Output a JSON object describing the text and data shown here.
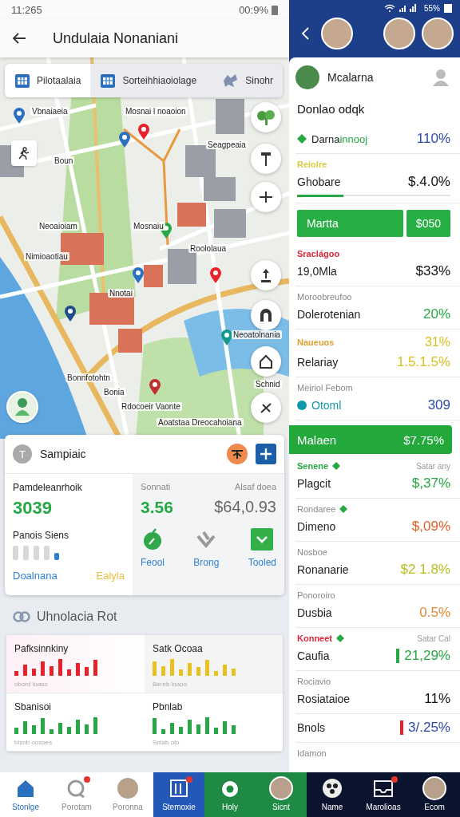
{
  "left_status": {
    "time": "11:265",
    "battery": "00:9%"
  },
  "right_status": {
    "battery": "55%"
  },
  "app_bar": {
    "title": "Undulaia Nonaniani"
  },
  "map_tabs": [
    {
      "label": "Pilotaalaia",
      "selected": true
    },
    {
      "label": "Sorteihhiaoiolage",
      "selected": false
    },
    {
      "label": "Sinohr",
      "selected": false
    }
  ],
  "map_labels": [
    {
      "text": "Vbnaiaeia"
    },
    {
      "text": "Mosnai l noaoion"
    },
    {
      "text": "Boun"
    },
    {
      "text": "Seagpeaia"
    },
    {
      "text": "Neoaioiam"
    },
    {
      "text": "Mosnaiu"
    },
    {
      "text": "Nimioaotiau"
    },
    {
      "text": "Roololaua"
    },
    {
      "text": "Nnotai"
    },
    {
      "text": "Neoatolnania"
    },
    {
      "text": "Bonnfotohtn"
    },
    {
      "text": "Bonia"
    },
    {
      "text": "Rdocoeir Vaonte"
    },
    {
      "text": "Aoatstaa Dreocahoiana"
    },
    {
      "text": "Schnid"
    }
  ],
  "summary_card": {
    "avatar_letter": "T",
    "title": "Sampiaic",
    "left": {
      "label": "Pamdeleanrhoik",
      "value": "3039",
      "sublabel": "Panois Siens",
      "links": [
        {
          "text": "Doalnana",
          "color": "#2f7fd0"
        },
        {
          "text": "Ealyla",
          "color": "#e8c040"
        }
      ]
    },
    "stats": [
      {
        "label": "Sonnati",
        "value": "3.56",
        "color": "#27a844"
      },
      {
        "label": "Alsaf doea",
        "value": "$64,0.93",
        "color": "#666666"
      }
    ],
    "actions": [
      {
        "kind": "apple",
        "label": "Feool"
      },
      {
        "kind": "chevron",
        "label": "Brong"
      },
      {
        "kind": "check",
        "label": "Tooled"
      }
    ]
  },
  "section": {
    "title": "Uhnolacia Rot"
  },
  "tiles": [
    {
      "title": "Pafksinnkiny",
      "caption": "obord loaso",
      "color": "#e8212a"
    },
    {
      "title": "Satk Ocoaa",
      "caption": "Bereb loaoo",
      "color": "#e8c020"
    },
    {
      "title": "Sbanisoi",
      "caption": "bisnb oosoes",
      "color": "#27a844"
    },
    {
      "title": "Pbnlab",
      "caption": "Snlab olo",
      "color": "#27a844"
    }
  ],
  "profile": {
    "name": "Mcalarna",
    "heading": "Donlao odqk"
  },
  "rows": [
    {
      "kind": "tagged",
      "label": "Darna",
      "accent": "innooj",
      "value": "110%",
      "color": "#2a4aa8"
    },
    {
      "kind": "plain",
      "caption": {
        "text": "Reiolre",
        "color": "#d8cc40"
      },
      "label": "Ghobare",
      "value": "$.4.0%",
      "color": "#111111",
      "level": 0.3
    },
    {
      "kind": "button",
      "label": "Martta",
      "value": "$050"
    },
    {
      "kind": "plain",
      "caption": {
        "text": "Sraclágoo",
        "color": "#d8283c"
      },
      "label": "19,0Mla",
      "value": "$33%",
      "color": "#111111"
    },
    {
      "kind": "plain",
      "caption": {
        "text": "Moroobreufoo"
      },
      "label": "Dolerotenian",
      "value": "20%",
      "color": "#27a844"
    },
    {
      "kind": "plain",
      "caption": {
        "text": "Naueuos",
        "color": "#e0a030"
      },
      "caption_value": "31%",
      "label": "Relariay",
      "value": "1.5.1.5%",
      "color": "#d8c020"
    },
    {
      "kind": "status",
      "caption": {
        "text": "Meiriol Febom"
      },
      "label": "Otoml",
      "value": "309",
      "color": "#2a4aa8"
    },
    {
      "kind": "banner",
      "label": "Malaen",
      "value": "$7.75%"
    },
    {
      "kind": "plain",
      "caption": {
        "text": "Senene",
        "color": "#27a844",
        "marked": true
      },
      "caption_right": "Satar any",
      "label": "Plagcit",
      "value": "$,37%",
      "color": "#27a844"
    },
    {
      "kind": "plain",
      "caption": {
        "text": "Rondaree",
        "marked": true
      },
      "label": "Dimeno",
      "value": "$,09%",
      "color": "#e0602a"
    },
    {
      "kind": "plain",
      "caption": {
        "text": "Nosboe"
      },
      "label": "Ronanarie",
      "value": "$2 1.8%",
      "color": "#b8c020"
    },
    {
      "kind": "plain",
      "caption": {
        "text": "Ponoroiro"
      },
      "label": "Dusbia",
      "value": "0.5%",
      "color": "#e08a30"
    },
    {
      "kind": "plain",
      "caption": {
        "text": "Konneet",
        "color": "#d8283c",
        "marked": true
      },
      "caption_right": "Satar Cal",
      "label": "Caufia",
      "value": "21,29%",
      "color": "#27a844",
      "bar": {
        "color": "#27a844"
      }
    },
    {
      "kind": "plain",
      "caption": {
        "text": "Rociavio"
      },
      "label": "Rosiataioe",
      "value": "11%",
      "color": "#111111"
    },
    {
      "kind": "plain",
      "label": "Bnols",
      "value": "3/.25%",
      "color": "#2a4aa8",
      "bar": {
        "color": "#e8212a"
      }
    },
    {
      "kind": "plain",
      "caption": {
        "text": "Idamon"
      }
    }
  ],
  "bottom_nav": [
    {
      "label": "Stonlge",
      "selected": true,
      "badge": false
    },
    {
      "label": "Porotam",
      "selected": false,
      "badge": true
    },
    {
      "label": "Poronna",
      "selected": false,
      "badge": false
    },
    {
      "label": "Stemoxie",
      "selected": false,
      "badge": true
    },
    {
      "label": "Holy",
      "selected": false,
      "badge": false
    },
    {
      "label": "Sicnt",
      "selected": false,
      "badge": false
    },
    {
      "label": "Name",
      "selected": false,
      "badge": false
    },
    {
      "label": "Marolioas",
      "selected": false,
      "badge": true
    },
    {
      "label": "Ecom",
      "selected": false,
      "badge": false
    }
  ]
}
